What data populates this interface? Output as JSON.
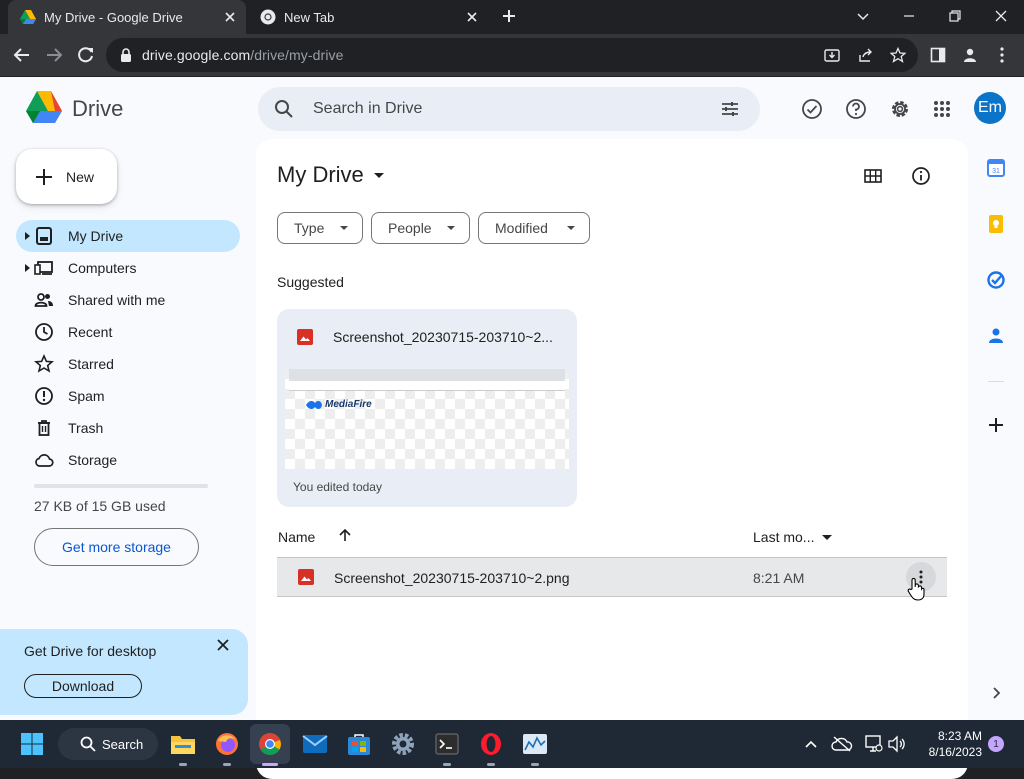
{
  "browser": {
    "tabs": [
      {
        "title": "My Drive - Google Drive",
        "active": true
      },
      {
        "title": "New Tab",
        "active": false
      }
    ],
    "url_host": "drive.google.com",
    "url_path": "/drive/my-drive"
  },
  "drive": {
    "logo_text": "Drive",
    "search_placeholder": "Search in Drive",
    "account_initials": "Em",
    "new_label": "New",
    "nav": [
      {
        "label": "My Drive",
        "icon": "my-drive-icon",
        "active": true
      },
      {
        "label": "Computers",
        "icon": "computers-icon"
      },
      {
        "label": "Shared with me",
        "icon": "shared-icon"
      },
      {
        "label": "Recent",
        "icon": "clock-icon"
      },
      {
        "label": "Starred",
        "icon": "star-icon"
      },
      {
        "label": "Spam",
        "icon": "spam-icon"
      },
      {
        "label": "Trash",
        "icon": "trash-icon"
      },
      {
        "label": "Storage",
        "icon": "cloud-icon"
      }
    ],
    "storage_text": "27 KB of 15 GB used",
    "storage_used_fraction": 0.0,
    "get_storage_label": "Get more storage",
    "promo_title": "Get Drive for desktop",
    "promo_button": "Download",
    "page_title": "My Drive",
    "filters": [
      "Type",
      "People",
      "Modified"
    ],
    "suggested_heading": "Suggested",
    "suggested_file": {
      "name": "Screenshot_20230715-203710~2...",
      "subtitle": "You edited today",
      "thumb_logo": "MediaFire"
    },
    "columns": {
      "name": "Name",
      "modified": "Last mo..."
    },
    "files": [
      {
        "name": "Screenshot_20230715-203710~2.png",
        "modified": "8:21 AM"
      }
    ]
  },
  "taskbar": {
    "search_label": "Search",
    "time": "8:23 AM",
    "date": "8/16/2023",
    "notification_count": "1"
  },
  "colors": {
    "accent_blue": "#0b57d0",
    "nav_active": "#c2e7ff",
    "search_bg": "#e9eef6",
    "app_bg": "#f8fafd",
    "image_file_red": "#d93025",
    "avatar": "#0b73c8"
  }
}
